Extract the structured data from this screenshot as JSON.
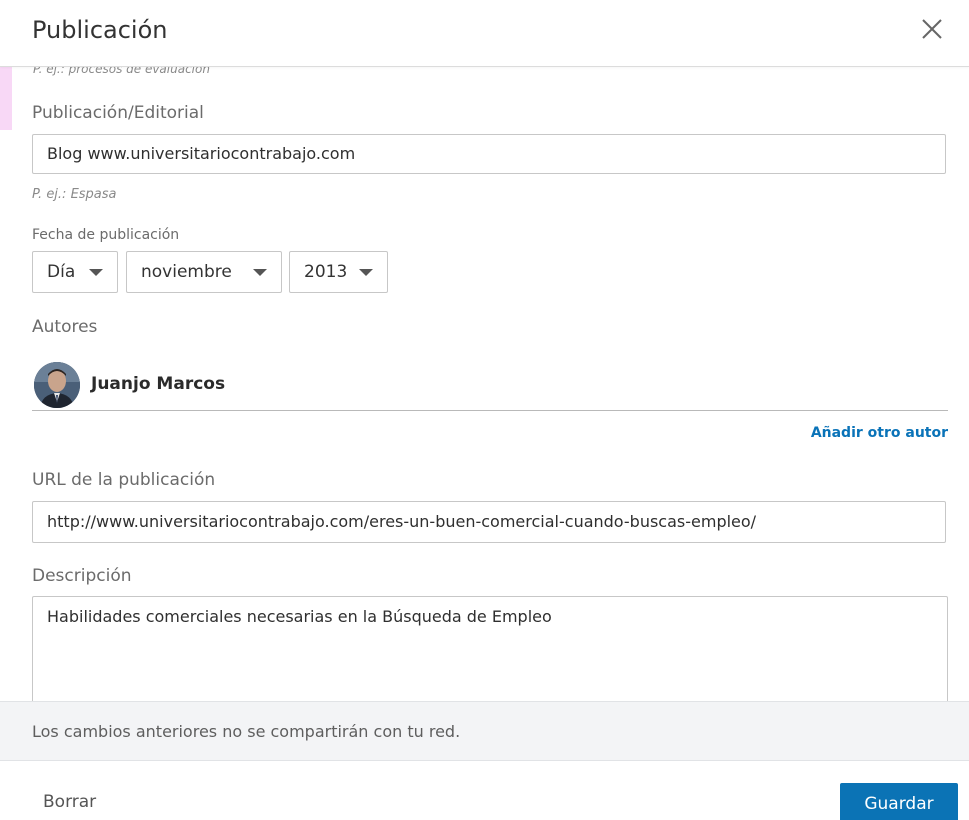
{
  "dialog": {
    "title": "Publicación",
    "close_icon": "close-icon"
  },
  "form": {
    "prev_hint": "P. ej.: procesos de evaluación",
    "publisher": {
      "label": "Publicación/Editorial",
      "value": "Blog www.universitariocontrabajo.com",
      "hint": "P. ej.: Espasa"
    },
    "date": {
      "label": "Fecha de publicación",
      "day": "Día",
      "month": "noviembre",
      "year": "2013"
    },
    "authors": {
      "label": "Autores",
      "list": [
        {
          "name": "Juanjo Marcos"
        }
      ],
      "add_link": "Añadir otro autor"
    },
    "url": {
      "label": "URL de la publicación",
      "value": "http://www.universitariocontrabajo.com/eres-un-buen-comercial-cuando-buscas-empleo/"
    },
    "description": {
      "label": "Descripción",
      "value": "Habilidades comerciales necesarias en la Búsqueda de Empleo"
    }
  },
  "notice": {
    "text": "Los cambios anteriores no se compartirán con tu red."
  },
  "footer": {
    "delete_label": "Borrar",
    "save_label": "Guardar"
  },
  "colors": {
    "accent": "#0b73b5",
    "link": "#0a73b8",
    "notice_bg": "#f3f4f6"
  }
}
